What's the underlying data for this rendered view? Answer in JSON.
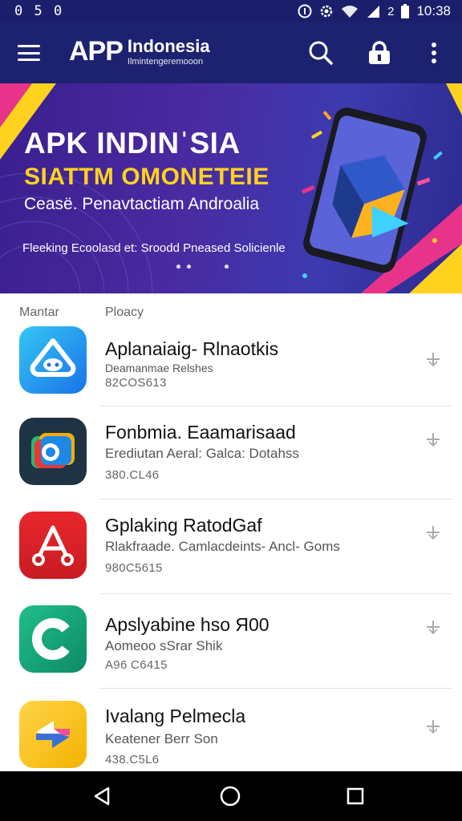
{
  "status_bar": {
    "left_text": "0 5 0",
    "time": "10:38",
    "battery_text": "2",
    "icons": [
      "info-icon",
      "gear-icon",
      "wifi-icon",
      "signal-icon",
      "battery-icon"
    ]
  },
  "app_bar": {
    "logo_text": "APP",
    "brand_name": "Indonesia",
    "brand_sub": "Ilmintengeremooon",
    "icons": [
      "menu-icon",
      "search-icon",
      "lock-icon",
      "more-vert-icon"
    ]
  },
  "banner": {
    "title": "APK INDINˈSIA",
    "subtitle": "SIATTM OMONETEIE",
    "tagline": "Ceasë. Penavtactiam Androalia",
    "caption": "Fleeking Ecoolasd et: Sroodd Pneased Solicienle",
    "colors": {
      "accent_yellow": "#ffd21f",
      "accent_pink": "#e8338a",
      "bg": "#3a1f8f"
    }
  },
  "list_header": {
    "left": "Mantar",
    "right": "Ploacy"
  },
  "apps": [
    {
      "name": "Aplanaiaig- Rlnaotkis",
      "desc": "Deamanmae Relshes",
      "meta": "82COS613",
      "icon": "chat-cloud-icon",
      "color": "#2196f3"
    },
    {
      "name": "Fonbmia. Eaamarisaad",
      "desc": "Erediutan Aeral: Galca: Dotahss",
      "meta": "380.CL46",
      "icon": "camera-icon",
      "color": "#1e3a4c"
    },
    {
      "name": "Gplaking RatodGaf",
      "desc": "Rlakfraade. Camlacdeints- Ancl- Goms",
      "meta": "980C5615",
      "icon": "compass-icon",
      "color": "#d8232a"
    },
    {
      "name": "Apslyabine hso Я00",
      "desc": "Aomeoo sSrar Shik",
      "meta": "A96 C6415",
      "icon": "c-logo-icon",
      "color": "#16a37a"
    },
    {
      "name": "Ivalang Pelmecla",
      "desc": "Keatener Berr Son",
      "meta": "438.C5L6",
      "icon": "share-arrows-icon",
      "color": "#f6c21b"
    }
  ],
  "nav_bar": {
    "icons": [
      "back-icon",
      "home-icon",
      "recents-icon"
    ]
  }
}
